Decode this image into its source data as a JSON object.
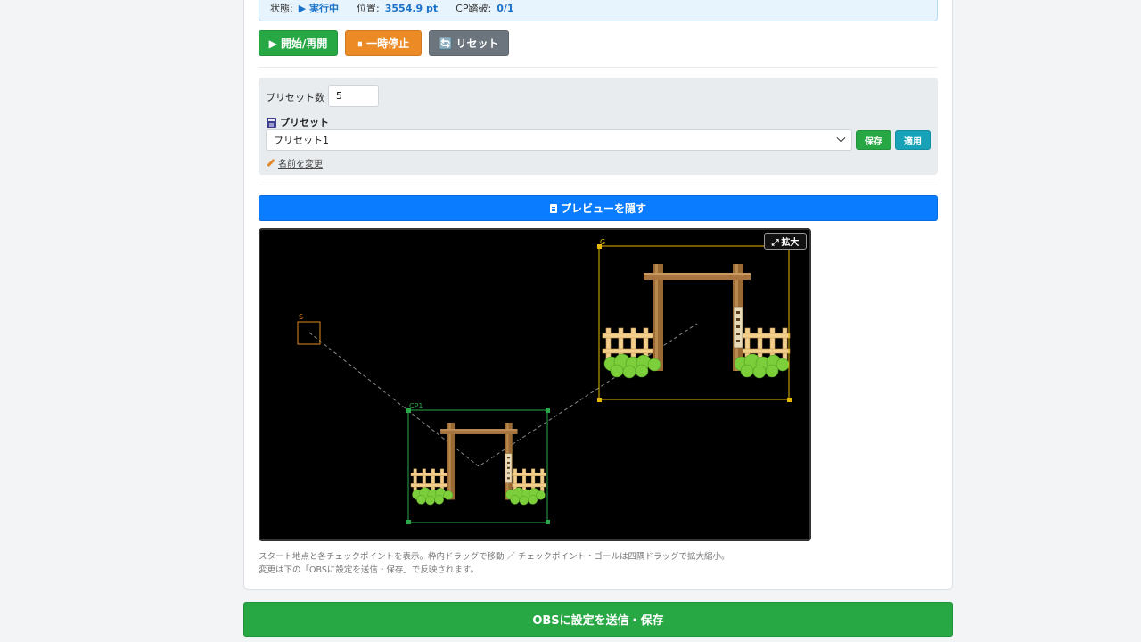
{
  "status": {
    "state_label": "状態:",
    "state_value": "▶ 実行中",
    "position_label": "位置:",
    "position_value": "3554.9 pt",
    "cp_label": "CP踏破:",
    "cp_value": "0/1"
  },
  "controls": {
    "start_label": "▶ 開始/再開",
    "pause_label": "⏸ 一時停止",
    "reset_label": "🔄 リセット"
  },
  "preset": {
    "count_label": "プリセット数",
    "count_value": "5",
    "heading": "プリセット",
    "selected": "プリセット1",
    "save_label": "保存",
    "apply_label": "適用",
    "rename_label": "名前を変更"
  },
  "preview": {
    "toggle_label": "プレビューを隠す",
    "zoom_label": "⤢ 拡大",
    "start_marker": "S",
    "checkpoint_marker": "CP1",
    "goal_marker": "G",
    "colors": {
      "start": "#e08a1e",
      "checkpoint": "#2aa84a",
      "goal": "#e6b800"
    }
  },
  "notes": {
    "line1": "スタート地点と各チェックポイントを表示。枠内ドラッグで移動 ／ チェックポイント・ゴールは四隅ドラッグで拡大縮小。",
    "line2": "変更は下の「OBSに設定を送信・保存」で反映されます。"
  },
  "footer": {
    "send_label": "OBSに設定を送信・保存"
  }
}
